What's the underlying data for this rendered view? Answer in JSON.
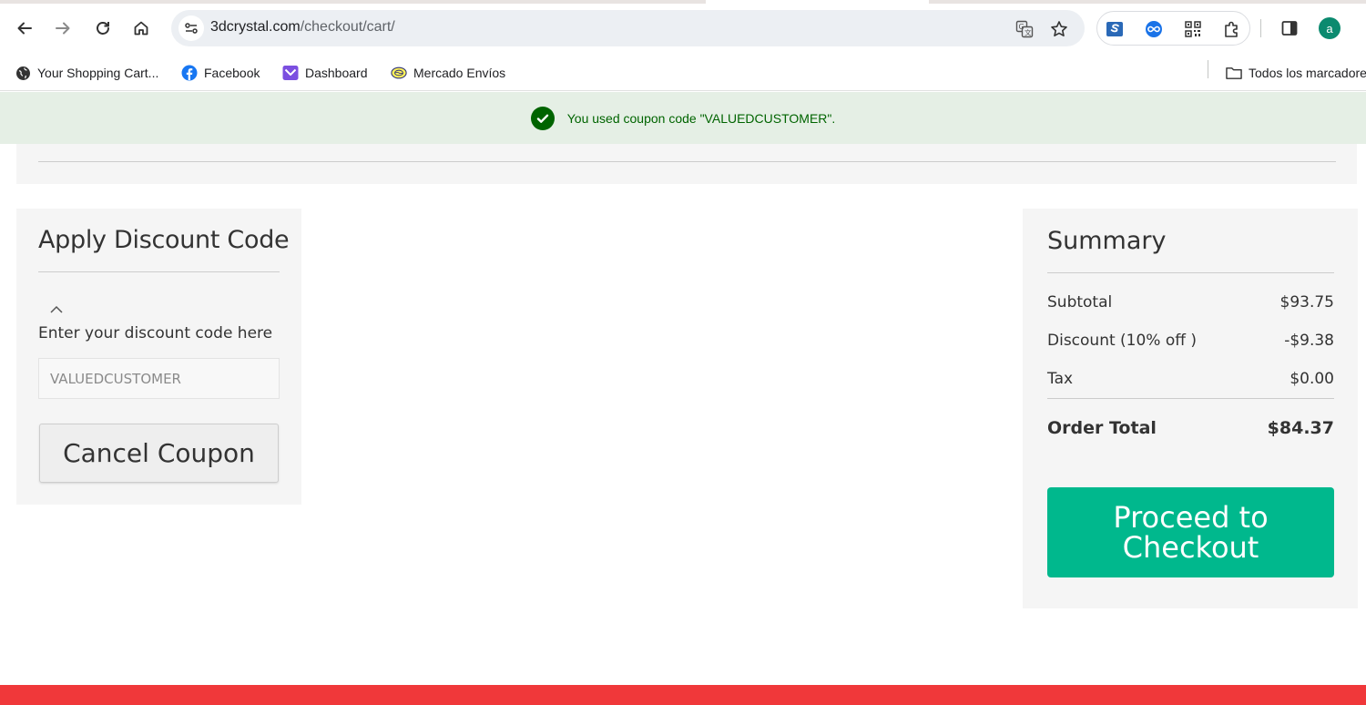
{
  "browser": {
    "url_domain": "3dcrystal.com",
    "url_path": "/checkout/cart/",
    "profile_initial": "a",
    "bookmarks": [
      {
        "label": "Your Shopping Cart...",
        "icon": "globe-icon"
      },
      {
        "label": "Facebook",
        "icon": "facebook-icon"
      },
      {
        "label": "Dashboard",
        "icon": "dashboard-icon"
      },
      {
        "label": "Mercado Envíos",
        "icon": "mercado-icon"
      }
    ],
    "all_bookmarks_label": "Todos los marcadores"
  },
  "notice": {
    "message": "You used coupon code \"VALUEDCUSTOMER\"."
  },
  "discount": {
    "title": "Apply Discount Code",
    "label": "Enter your discount code here",
    "code_value": "VALUEDCUSTOMER",
    "cancel_label": "Cancel Coupon"
  },
  "summary": {
    "title": "Summary",
    "subtotal_label": "Subtotal",
    "subtotal_value": "$93.75",
    "discount_label": "Discount (10% off )",
    "discount_value": "-$9.38",
    "tax_label": "Tax",
    "tax_value": "$0.00",
    "total_label": "Order Total",
    "total_value": "$84.37",
    "checkout_label": "Proceed to Checkout"
  },
  "colors": {
    "accent": "#00b88d",
    "notice_bg": "#e5efe5",
    "notice_text": "#006400",
    "footer": "#f0383a"
  }
}
